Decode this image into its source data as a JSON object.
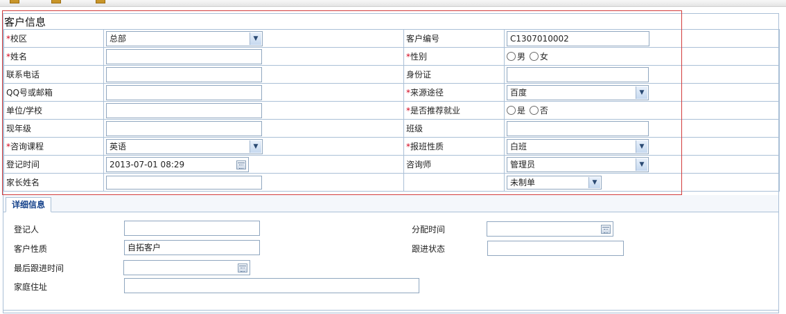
{
  "form": {
    "title": "客户信息",
    "rows": [
      {
        "l1": "校区",
        "req1": true,
        "v1": "总部",
        "l2": "客户编号",
        "req2": false,
        "v2": "C1307010002"
      },
      {
        "l1": "姓名",
        "req1": true,
        "v1": "",
        "l2": "性别",
        "req2": true,
        "v2": ""
      },
      {
        "l1": "联系电话",
        "req1": false,
        "v1": "",
        "l2": "身份证",
        "req2": false,
        "v2": ""
      },
      {
        "l1": "QQ号或邮箱",
        "req1": false,
        "v1": "",
        "l2": "来源途径",
        "req2": true,
        "v2": "百度"
      },
      {
        "l1": "单位/学校",
        "req1": false,
        "v1": "",
        "l2": "是否推荐就业",
        "req2": true,
        "v2": ""
      },
      {
        "l1": "现年级",
        "req1": false,
        "v1": "",
        "l2": "班级",
        "req2": false,
        "v2": ""
      },
      {
        "l1": "咨询课程",
        "req1": true,
        "v1": "英语",
        "l2": "报班性质",
        "req2": true,
        "v2": "白班"
      },
      {
        "l1": "登记时间",
        "req1": false,
        "v1": "2013-07-01 08:29",
        "l2": "咨询师",
        "req2": false,
        "v2": "管理员"
      },
      {
        "l1": "家长姓名",
        "req1": false,
        "v1": "",
        "l2": "",
        "req2": false,
        "v2": "未制单"
      }
    ],
    "required_mark": "*",
    "gender_options": [
      "男",
      "女"
    ],
    "recommend_options": [
      "是",
      "否"
    ]
  },
  "detail": {
    "tab_label": "详细信息",
    "registrar_label": "登记人",
    "registrar_value": "",
    "assign_time_label": "分配时间",
    "assign_time_value": "",
    "customer_type_label": "客户性质",
    "customer_type_value": "自拓客户",
    "follow_status_label": "跟进状态",
    "follow_status_value": "",
    "last_follow_label": "最后跟进时间",
    "last_follow_value": "",
    "address_label": "家庭住址",
    "address_value": ""
  },
  "colors": {
    "required": "#d0021b",
    "border": "#a9bfd6",
    "highlight_frame": "#d23b3b",
    "tab_text": "#15428b"
  },
  "icons": {
    "dropdown": "chevron-down-icon",
    "calendar": "calendar-icon"
  }
}
